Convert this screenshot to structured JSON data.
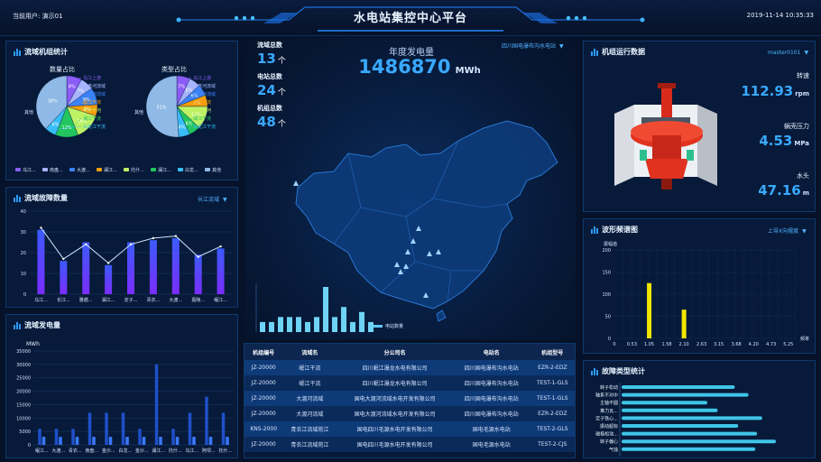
{
  "header": {
    "title": "水电站集控中心平台",
    "user_label": "当前用户: 演示01",
    "datetime": "2019-11-14 10:35:33"
  },
  "colors": {
    "accent": "#39a9ff",
    "bar": "#2d6dff",
    "yellow": "#f2e600",
    "cyan": "#3fc5e8"
  },
  "basin_pie": {
    "title": "流域机组统计",
    "left_title": "数量占比",
    "right_title": "类型占比",
    "left_slices": [
      {
        "label": "乌江上游",
        "pct": 8,
        "color": "#8b5cf6"
      },
      {
        "label": "南盘河流域",
        "pct": 7,
        "color": "#a5b4fc"
      },
      {
        "label": "大渡河流域",
        "pct": 9,
        "color": "#3b82f6"
      },
      {
        "label": "澜江干流",
        "pct": 6,
        "color": "#f59e0b"
      },
      {
        "label": "托什干河",
        "pct": 14,
        "color": "#bef264"
      },
      {
        "label": "澜江干流",
        "pct": 12,
        "color": "#22c55e"
      },
      {
        "label": "白龙江干流",
        "pct": 6,
        "color": "#38bdf8"
      },
      {
        "label": "其他",
        "pct": 38,
        "color": "#8fb9e6"
      }
    ],
    "right_slices": [
      {
        "label": "乌江上游",
        "pct": 7,
        "color": "#8b5cf6"
      },
      {
        "label": "南盘河流域",
        "pct": 6,
        "color": "#a5b4fc"
      },
      {
        "label": "大渡河流域",
        "pct": 6,
        "color": "#3b82f6"
      },
      {
        "label": "澜江干流",
        "pct": 6,
        "color": "#f59e0b"
      },
      {
        "label": "托什干河",
        "pct": 12,
        "color": "#bef264"
      },
      {
        "label": "澜江干流",
        "pct": 6,
        "color": "#22c55e"
      },
      {
        "label": "白龙江干流",
        "pct": 6,
        "color": "#38bdf8"
      },
      {
        "label": "其他",
        "pct": 51,
        "color": "#8fb9e6"
      }
    ],
    "left_pct_labels": [
      "8%",
      "7%",
      "9%",
      "6%",
      "14%",
      "12%",
      "6%",
      "38%"
    ],
    "right_pct_labels": [
      "7%",
      "6%",
      "6%",
      "6%",
      "12%",
      "6%",
      "6%",
      "51%"
    ],
    "left_other": "其他",
    "right_other": "其他",
    "legend": [
      {
        "label": "乌江...",
        "color": "#8b5cf6"
      },
      {
        "label": "南盘...",
        "color": "#a5b4fc"
      },
      {
        "label": "大渡...",
        "color": "#3b82f6"
      },
      {
        "label": "澜江...",
        "color": "#f59e0b"
      },
      {
        "label": "托什...",
        "color": "#bef264"
      },
      {
        "label": "澜江...",
        "color": "#22c55e"
      },
      {
        "label": "白龙...",
        "color": "#38bdf8"
      },
      {
        "label": "其他",
        "color": "#8fb9e6"
      }
    ]
  },
  "fault_panel": {
    "title": "流域故障数量",
    "selector": "长江流域"
  },
  "output_panel": {
    "title": "流域发电量",
    "unit": "MWh"
  },
  "center": {
    "stats": [
      {
        "label": "流域总数",
        "value": "13",
        "unit": "个"
      },
      {
        "label": "电站总数",
        "value": "24",
        "unit": "个"
      },
      {
        "label": "机组总数",
        "value": "48",
        "unit": "个"
      }
    ],
    "annual_label": "年度发电量",
    "annual_value": "1486870",
    "annual_unit": "MWh",
    "station_selector": "四川国电瀑布沟水电站",
    "legend_label": "电站数量",
    "table": {
      "headers": [
        "机组编号",
        "流域名",
        "分公司名",
        "电站名",
        "机组型号"
      ],
      "rows": [
        [
          "JZ-20000",
          "岷江干流",
          "四川岷江瀑龙水电有限公司",
          "四川国电瀑布沟水电站",
          "EZR-2-EDZ"
        ],
        [
          "JZ-20000",
          "岷江干流",
          "四川岷江瀑龙水电有限公司",
          "四川国电瀑布沟水电站",
          "TEST-1-GLS"
        ],
        [
          "JZ-20000",
          "大渡河流域",
          "国电大渡河流域水电开发有限公司",
          "四川国电瀑布沟水电站",
          "TEST-1-GLS"
        ],
        [
          "JZ-20000",
          "大渡河流域",
          "国电大渡河流域水电开发有限公司",
          "四川国电瀑布沟水电站",
          "EZR-2-EDZ"
        ],
        [
          "KNS-2000",
          "青衣江流域苑江",
          "国电四川毛源水电开发有限公司",
          "国电毛源水电站",
          "TEST-2-GLS"
        ],
        [
          "JZ-20000",
          "青衣江流域苑江",
          "国电四川毛源水电开发有限公司",
          "国电毛源水电站",
          "TEST-2-CJS"
        ]
      ]
    }
  },
  "unit_panel": {
    "title": "机组运行数据",
    "selector": "master0101",
    "items": [
      {
        "label": "转速",
        "value": "112.93",
        "unit": "rpm"
      },
      {
        "label": "蜗壳压力",
        "value": "4.53",
        "unit": "MPa"
      },
      {
        "label": "水头",
        "value": "47.16",
        "unit": "m"
      }
    ]
  },
  "spectrum_panel": {
    "title": "波形频谱图",
    "selector": "上导X向摆度"
  },
  "fault_type_panel": {
    "title": "故障类型统计"
  },
  "chart_data": [
    {
      "type": "line",
      "title": "流域故障数量",
      "categories": [
        "乌江...",
        "长江...",
        "雅砻...",
        "澜江...",
        "定子...",
        "青衣...",
        "大渡...",
        "嘉陵...",
        "岷江..."
      ],
      "series": [
        {
          "name": "",
          "kind": "bar",
          "values": [
            31,
            16,
            25,
            14,
            25,
            26,
            27,
            19,
            22
          ]
        },
        {
          "name": "",
          "kind": "line",
          "values": [
            32,
            17,
            24,
            15,
            24,
            27,
            28,
            18,
            23
          ]
        }
      ],
      "ylim": [
        0,
        40
      ],
      "yticks": [
        0,
        10,
        20,
        30,
        40
      ]
    },
    {
      "type": "bar",
      "title": "流域发电量",
      "ylabel": "MWh",
      "categories": [
        "岷江...",
        "大渡...",
        "青衣...",
        "南盘...",
        "金沙...",
        "白龙...",
        "金沙...",
        "澜江...",
        "托什...",
        "乌江...",
        "阿坝...",
        "托什..."
      ],
      "values": [
        6000,
        6000,
        6000,
        12000,
        12000,
        12000,
        6000,
        30000,
        6000,
        12000,
        18000,
        12000
      ],
      "values2": [
        3000,
        3000,
        3000,
        3000,
        3000,
        3000,
        3000,
        3000,
        3000,
        3000,
        3000,
        3000
      ],
      "ylim": [
        0,
        35000
      ],
      "yticks": [
        0,
        5000,
        10000,
        15000,
        20000,
        25000,
        30000,
        35000
      ]
    },
    {
      "type": "bar",
      "title": "电站数量",
      "values": [
        2,
        2,
        3,
        3,
        3,
        2,
        3,
        9,
        3,
        5,
        2,
        4,
        2
      ]
    },
    {
      "type": "bar",
      "title": "波形频谱图",
      "ylabel": "振幅值",
      "xlabel": "频率",
      "categories": [
        "0",
        "0.53",
        "1.05",
        "1.58",
        "2.10",
        "2.63",
        "3.15",
        "3.68",
        "4.20",
        "4.73",
        "5.25"
      ],
      "bars": [
        {
          "x": 1.05,
          "value": 125
        },
        {
          "x": 2.1,
          "value": 65
        }
      ],
      "xlim": [
        0,
        5.5
      ],
      "ylim": [
        0,
        200
      ],
      "yticks": [
        0,
        50,
        100,
        150,
        200
      ]
    },
    {
      "type": "bar",
      "title": "故障类型统计",
      "orientation": "horizontal",
      "categories": [
        "转子松动",
        "轴系不对中",
        "主轴不圆",
        "推力瓦...",
        "定子铁心...",
        "振动超标",
        "磁极松动...",
        "转子偏心",
        "气蚀"
      ],
      "values": [
        0.66,
        0.74,
        0.5,
        0.56,
        0.82,
        0.68,
        0.79,
        0.9,
        0.78
      ],
      "xlim": [
        0,
        1
      ]
    }
  ]
}
